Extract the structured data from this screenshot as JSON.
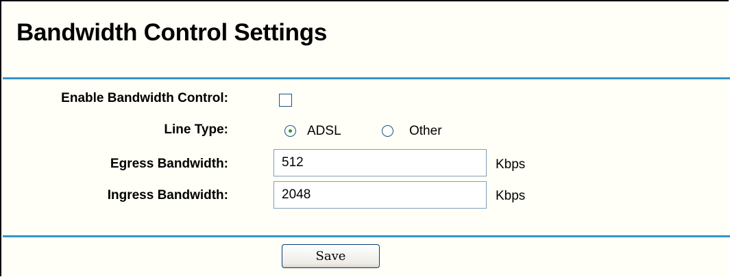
{
  "page": {
    "title": "Bandwidth Control Settings"
  },
  "form": {
    "enable": {
      "label": "Enable Bandwidth Control:",
      "checked": false
    },
    "line_type": {
      "label": "Line Type:",
      "options": [
        {
          "label": "ADSL",
          "selected": true
        },
        {
          "label": "Other",
          "selected": false
        }
      ]
    },
    "egress": {
      "label": "Egress Bandwidth:",
      "value": "512",
      "unit": "Kbps"
    },
    "ingress": {
      "label": "Ingress Bandwidth:",
      "value": "2048",
      "unit": "Kbps"
    },
    "save_label": "Save"
  },
  "colors": {
    "page_background": "#fffff7",
    "rule_accent": "#3494c8",
    "radio_selected": "#21a121",
    "control_border": "#1c5180"
  }
}
